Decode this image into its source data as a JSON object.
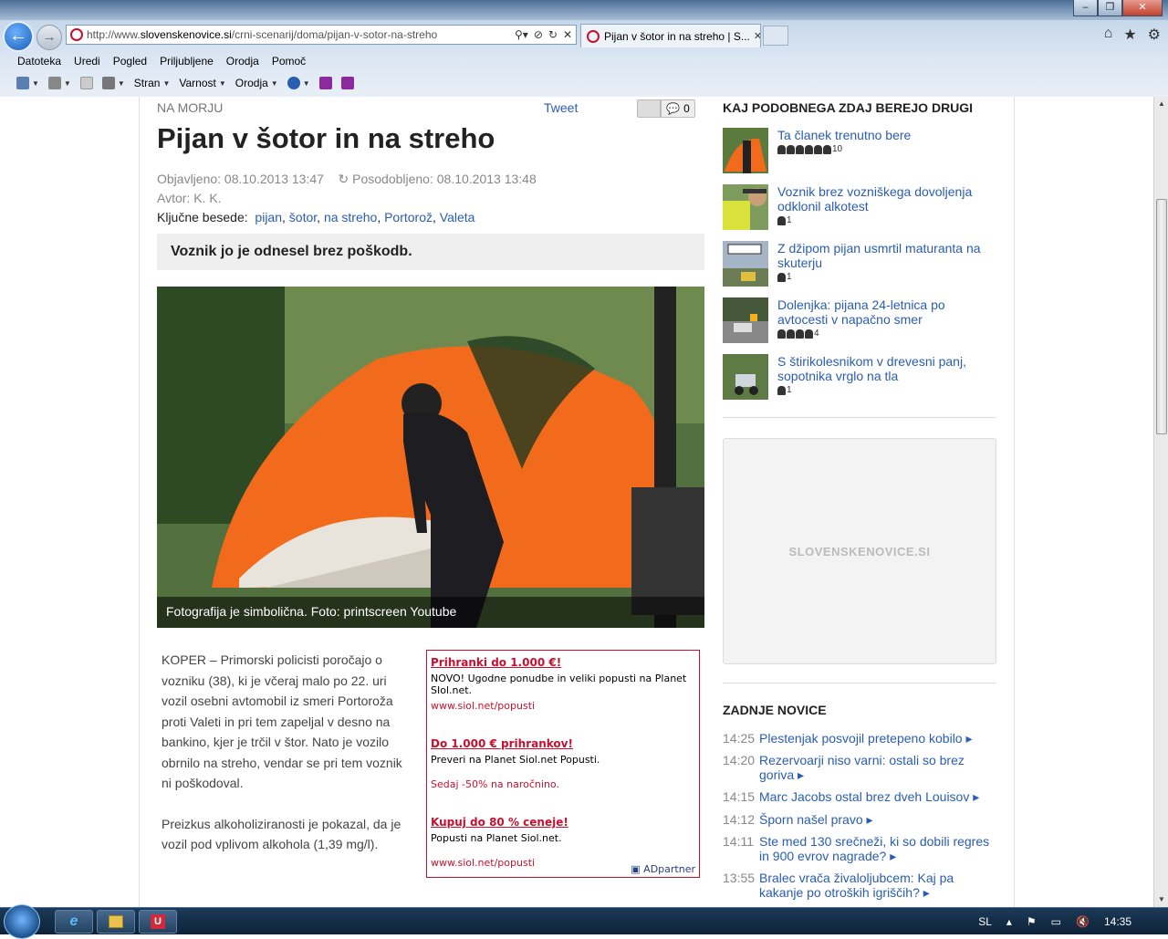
{
  "browser": {
    "url_prefix": "http://www.",
    "url_domain": "slovenskenovice.si",
    "url_path": "/crni-scenarij/doma/pijan-v-sotor-na-streho",
    "tab_title": "Pijan v šotor in na streho | S...",
    "menu": [
      "Datoteka",
      "Uredi",
      "Pogled",
      "Priljubljene",
      "Orodja",
      "Pomoč"
    ],
    "cmd": {
      "page": "Stran",
      "safety": "Varnost",
      "tools": "Orodja"
    }
  },
  "article": {
    "section": "NA MORJU",
    "tweet": "Tweet",
    "comments": "0",
    "title": "Pijan v šotor in na streho",
    "published": "Objavljeno: 08.10.2013 13:47",
    "updated": "Posodobljeno: 08.10.2013 13:48",
    "author": "Avtor: K. K.",
    "keywords_label": "Ključne besede:",
    "keywords": [
      "pijan",
      "šotor",
      "na streho",
      "Portorož",
      "Valeta"
    ],
    "lead": "Voznik jo je odnesel brez poškodb.",
    "caption": "Fotografija je simbolična. Foto: printscreen Youtube",
    "p1": "KOPER – Primorski policisti poročajo o vozniku (38), ki je včeraj malo po 22. uri vozil osebni avtomobil iz smeri Portoroža proti Valeti in pri tem zapeljal v desno na bankino, kjer je trčil v štor. Nato je vozilo obrnilo na streho, vendar se pri tem voznik ni poškodoval.",
    "p2": "Preizkus alkoholiziranosti je pokazal, da je vozil pod vplivom alkohola (1,39 mg/l)."
  },
  "ad": {
    "h1": "Prihranki do 1.000 €!",
    "t1": "NOVO! Ugodne ponudbe in veliki popusti na Planet SIol.net.",
    "u1": "www.siol.net/popusti",
    "h2": "Do 1.000 € prihrankov!",
    "t2": "Preveri na Planet Siol.net Popusti.",
    "u2": "Sedaj -50% na naročnino.",
    "h3": "Kupuj do 80 % ceneje!",
    "t3": "Popusti na Planet Siol.net.",
    "u3": "www.siol.net/popusti",
    "partner": "ADpartner"
  },
  "sidebar": {
    "heading": "KAJ PODOBNEGA ZDAJ BEREJO DRUGI",
    "related": [
      {
        "title": "Ta članek trenutno bere",
        "count": "10"
      },
      {
        "title": "Voznik brez vozniškega dovoljenja odklonil alkotest",
        "count": "1"
      },
      {
        "title": "Z džipom pijan usmrtil maturanta na skuterju",
        "count": "1"
      },
      {
        "title": "Dolenjka: pijana 24-letnica po avtocesti v napačno smer",
        "count": "4"
      },
      {
        "title": "S štirikolesnikom v drevesni panj, sopotnika vrglo na tla",
        "count": "1"
      }
    ],
    "ad_label": "SLOVENSKENOVICE.SI",
    "news_heading": "ZADNJE NOVICE",
    "news": [
      {
        "time": "14:25",
        "title": "Plestenjak posvojil pretepeno kobilo ▸"
      },
      {
        "time": "14:20",
        "title": "Rezervoarji niso varni: ostali so brez goriva ▸"
      },
      {
        "time": "14:15",
        "title": "Marc Jacobs ostal brez dveh Louisov ▸"
      },
      {
        "time": "14:12",
        "title": "Šporn našel pravo ▸"
      },
      {
        "time": "14:11",
        "title": "Ste med 130 srečneži, ki so dobili regres in 900 evrov nagrade? ▸"
      },
      {
        "time": "13:55",
        "title": "Bralec vrača živaloljubcem: Kaj pa kakanje po otroških igriščih? ▸"
      }
    ]
  },
  "taskbar": {
    "lang": "SL",
    "clock": "14:35"
  }
}
